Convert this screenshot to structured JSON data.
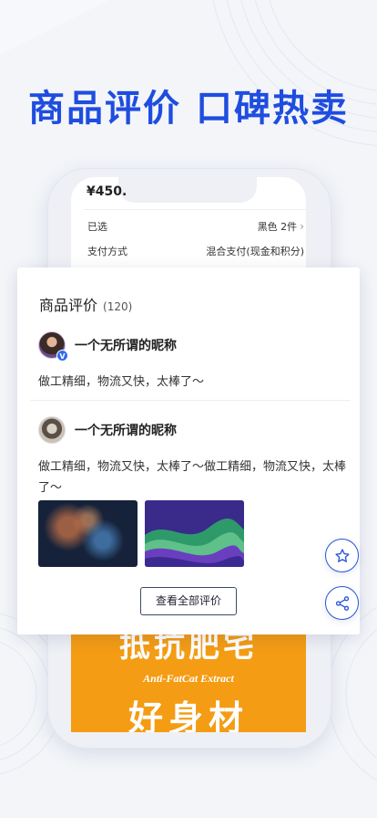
{
  "headline": "商品评价 口碑热卖",
  "product": {
    "price": "¥450.",
    "selected_label": "已选",
    "selected_value": "黑色 2件",
    "payment_label": "支付方式",
    "payment_value": "混合支付(现金和积分)"
  },
  "reviews_card": {
    "title": "商品评价",
    "count": "(120)",
    "reviews": [
      {
        "nickname": "一个无所谓的昵称",
        "text": "做工精细，物流又快，太棒了～",
        "badge": "V"
      },
      {
        "nickname": "一个无所谓的昵称",
        "text": "做工精细，物流又快，太棒了～做工精细，物流又快，太棒了～"
      }
    ],
    "view_all_label": "查看全部评价"
  },
  "promo": {
    "line1": "抵抗肥宅",
    "line2": "Anti-FatCat Extract",
    "line3": "好身材"
  },
  "actions": {
    "favorite_icon": "star-icon",
    "share_icon": "share-icon"
  },
  "colors": {
    "accent": "#1f4de0",
    "promo": "#f49c14"
  }
}
